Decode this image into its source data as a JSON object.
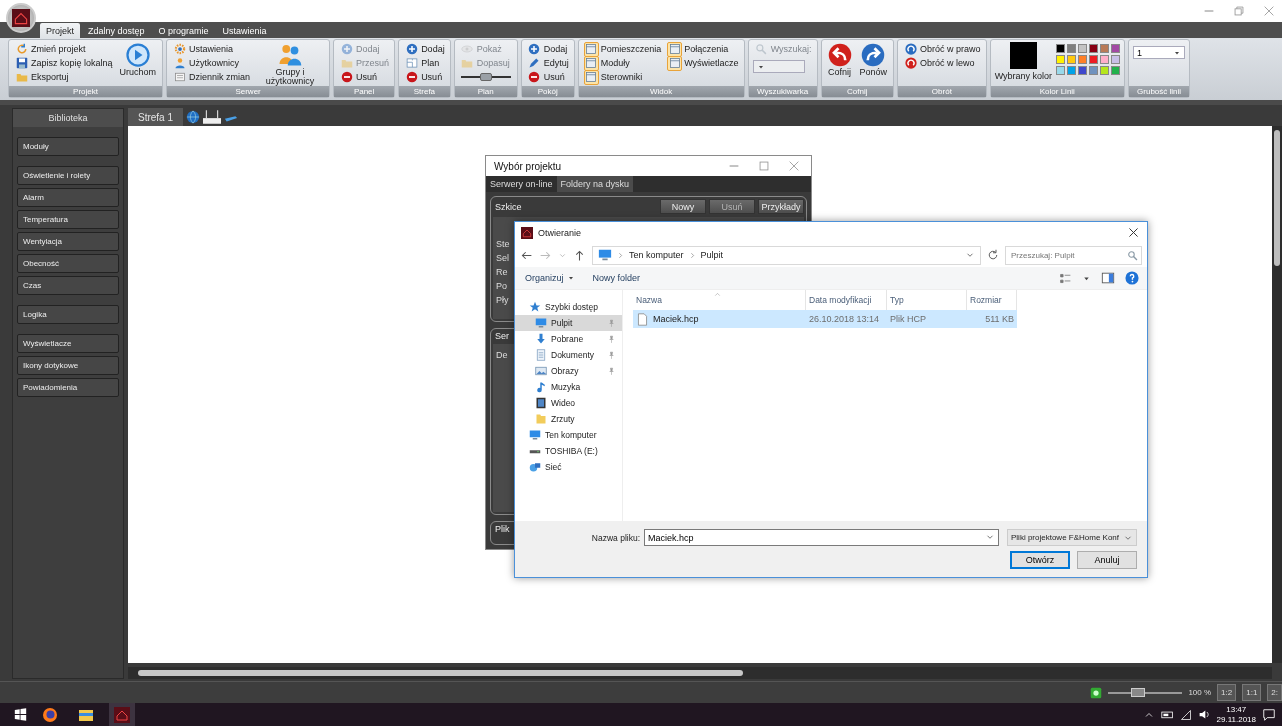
{
  "app_tabs": [
    {
      "label": "Projekt",
      "selected": true
    },
    {
      "label": "Zdalny dostęp",
      "selected": false
    },
    {
      "label": "O programie",
      "selected": false
    },
    {
      "label": "Ustawienia",
      "selected": false
    }
  ],
  "ribbon": {
    "groups": [
      {
        "label": "Projekt",
        "items": [
          {
            "kind": "small",
            "label": "Zmień projekt",
            "disabled": false
          },
          {
            "kind": "small",
            "label": "Zapisz kopię lokalną",
            "disabled": false
          },
          {
            "kind": "small",
            "label": "Eksportuj",
            "disabled": false
          },
          {
            "kind": "large",
            "label": "Uruchom",
            "disabled": false
          }
        ]
      },
      {
        "label": "Serwer",
        "items": [
          {
            "kind": "small",
            "label": "Ustawienia",
            "disabled": false
          },
          {
            "kind": "small",
            "label": "Użytkownicy",
            "disabled": false
          },
          {
            "kind": "small",
            "label": "Dziennik zmian",
            "disabled": false
          },
          {
            "kind": "large",
            "label": "Grupy i użytkownicy",
            "disabled": false
          }
        ]
      },
      {
        "label": "Panel",
        "items": [
          {
            "kind": "small",
            "label": "Dodaj",
            "disabled": true
          },
          {
            "kind": "small",
            "label": "Przesuń",
            "disabled": true
          },
          {
            "kind": "small",
            "label": "Usuń",
            "disabled": false
          }
        ]
      },
      {
        "label": "Strefa",
        "items": [
          {
            "kind": "small",
            "label": "Dodaj",
            "disabled": false
          },
          {
            "kind": "small",
            "label": "Plan",
            "disabled": false
          },
          {
            "kind": "small",
            "label": "Usuń",
            "disabled": false
          }
        ]
      },
      {
        "label": "Plan",
        "items": [
          {
            "kind": "small",
            "label": "Pokaż",
            "disabled": true
          },
          {
            "kind": "small",
            "label": "Dopasuj",
            "disabled": true
          },
          {
            "kind": "slider",
            "level": 0.5
          }
        ]
      },
      {
        "label": "Pokój",
        "items": [
          {
            "kind": "small",
            "label": "Dodaj",
            "disabled": false
          },
          {
            "kind": "small",
            "label": "Edytuj",
            "disabled": false
          },
          {
            "kind": "small",
            "label": "Usuń",
            "disabled": false
          }
        ]
      },
      {
        "label": "Widok",
        "items": [
          {
            "kind": "small",
            "label": "Pomieszczenia",
            "disabled": false,
            "on": true
          },
          {
            "kind": "small",
            "label": "Moduły",
            "disabled": false,
            "on": true
          },
          {
            "kind": "small",
            "label": "Sterowniki",
            "disabled": false,
            "on": true
          },
          {
            "kind": "small",
            "label": "Połączenia",
            "disabled": false,
            "on": true
          },
          {
            "kind": "small",
            "label": "Wyświetlacze",
            "disabled": false,
            "on": true
          }
        ]
      },
      {
        "label": "Wyszukiwarka",
        "items": [
          {
            "kind": "small",
            "label": "Wyszukaj:",
            "disabled": true
          },
          {
            "kind": "combo",
            "disabled": true
          }
        ]
      },
      {
        "label": "Cofnij",
        "items": [
          {
            "kind": "large",
            "label": "Cofnij",
            "disabled": false
          },
          {
            "kind": "large",
            "label": "Ponów",
            "disabled": false
          }
        ]
      },
      {
        "label": "Obrót",
        "items": [
          {
            "kind": "small",
            "label": "Obróć w prawo",
            "disabled": false
          },
          {
            "kind": "small",
            "label": "Obróć w lewo",
            "disabled": false
          }
        ]
      },
      {
        "label": "Kolor Linii",
        "items": [
          {
            "kind": "swatch",
            "label": "Wybrany kolor",
            "color": "#000000"
          },
          {
            "kind": "palette",
            "colors": [
              {
                "color": "#000000"
              },
              {
                "color": "#7f7f7f"
              },
              {
                "color": "#c3c3c3"
              },
              {
                "color": "#880015"
              },
              {
                "color": "#b97a57"
              },
              {
                "color": "#a349a4"
              },
              {
                "color": "#fff200"
              },
              {
                "color": "#ffc90e"
              },
              {
                "color": "#ff7f27"
              },
              {
                "color": "#ed1c24"
              },
              {
                "color": "#ffaec9"
              },
              {
                "color": "#c8bfe7"
              },
              {
                "color": "#99d9ea"
              },
              {
                "color": "#00a2e8"
              },
              {
                "color": "#3f48cc"
              },
              {
                "color": "#7092be"
              },
              {
                "color": "#b5e61d"
              },
              {
                "color": "#22b14c"
              }
            ]
          }
        ]
      },
      {
        "label": "Grubość linii",
        "items": [
          {
            "kind": "combo",
            "value": "1",
            "disabled": false
          }
        ]
      }
    ]
  },
  "sidebar": {
    "title": "Biblioteka",
    "groups": [
      {
        "items": [
          "Moduły"
        ]
      },
      {
        "items": [
          "Oświetlenie i rolety",
          "Alarm",
          "Temperatura",
          "Wentylacja",
          "Obecność",
          "Czas"
        ]
      },
      {
        "items": [
          "Logika"
        ]
      },
      {
        "items": [
          "Wyświetlacze",
          "Ikony dotykowe",
          "Powiadomienia"
        ]
      }
    ]
  },
  "canvas": {
    "tabs": [
      {
        "label": "Strefa 1",
        "selected": true
      }
    ]
  },
  "project_dialog": {
    "title": "Wybór projektu",
    "tabs": [
      {
        "label": "Serwery on-line",
        "selected": false
      },
      {
        "label": "Foldery na dysku",
        "selected": true
      }
    ],
    "sketches": {
      "title": "Szkice",
      "buttons": [
        {
          "label": "Nowy",
          "disabled": false
        },
        {
          "label": "Usuń",
          "disabled": true
        },
        {
          "label": "Przykłady",
          "disabled": false
        }
      ],
      "rows": [
        "Ste",
        "Sel",
        "Re",
        "Po",
        "Pły"
      ]
    },
    "servers": {
      "title": "Ser",
      "rows": [
        "De"
      ]
    },
    "file_group": {
      "title": "Plik"
    }
  },
  "open_dialog": {
    "title": "Otwieranie",
    "path": [
      "Ten komputer",
      "Pulpit"
    ],
    "search": {
      "placeholder": "Przeszukaj: Pulpit"
    },
    "organize": "Organizuj",
    "new_folder": "Nowy folder",
    "nav": [
      {
        "label": "Szybki dostęp",
        "selected": false,
        "children": [
          {
            "label": "Pulpit",
            "selected": true,
            "pinned": true
          },
          {
            "label": "Pobrane",
            "selected": false,
            "pinned": true
          },
          {
            "label": "Dokumenty",
            "selected": false,
            "pinned": true
          },
          {
            "label": "Obrazy",
            "selected": false,
            "pinned": true
          },
          {
            "label": "Muzyka",
            "selected": false,
            "pinned": false
          },
          {
            "label": "Wideo",
            "selected": false,
            "pinned": false
          },
          {
            "label": "Zrzuty",
            "selected": false,
            "pinned": false
          }
        ]
      },
      {
        "label": "Ten komputer",
        "selected": false
      },
      {
        "label": "TOSHIBA (E:)",
        "selected": false
      },
      {
        "label": "Sieć",
        "selected": false
      }
    ],
    "columns": [
      "Nazwa",
      "Data modyfikacji",
      "Typ",
      "Rozmiar"
    ],
    "files": [
      {
        "name": "Maciek.hcp",
        "modified": "26.10.2018 13:14",
        "type": "Plik HCP",
        "size": "511 KB",
        "selected": true
      }
    ],
    "filename": {
      "label": "Nazwa pliku:",
      "value": "Maciek.hcp"
    },
    "filter": "Pliki projektowe F&Home Konf",
    "buttons": [
      {
        "label": "Otwórz",
        "default": true
      },
      {
        "label": "Anuluj",
        "default": false
      }
    ]
  },
  "status_bar": {
    "zoom": {
      "level": 0.4
    },
    "zoom_reading": "100 %",
    "scale_buttons": [
      "1:2",
      "1:1",
      "2:"
    ]
  },
  "taskbar": {
    "apps": [
      {
        "selected": false
      },
      {
        "selected": false
      },
      {
        "selected": true
      }
    ],
    "time": "13:47",
    "date": "29.11.2018"
  }
}
